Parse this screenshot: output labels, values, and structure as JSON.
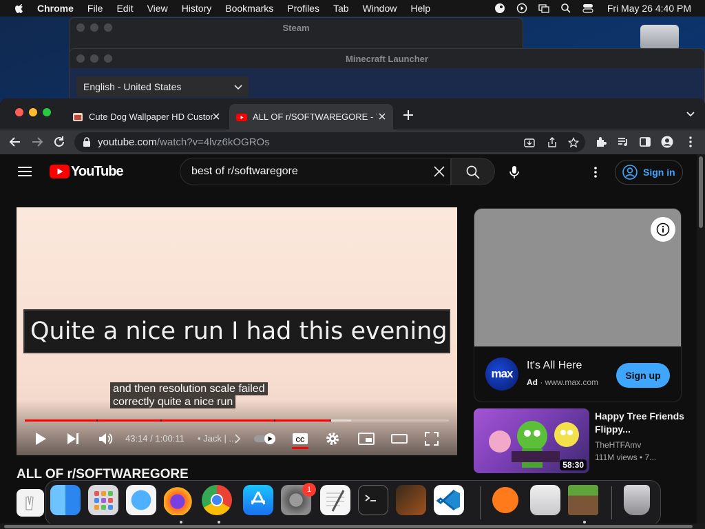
{
  "menubar": {
    "app": "Chrome",
    "items": [
      "File",
      "Edit",
      "View",
      "History",
      "Bookmarks",
      "Profiles",
      "Tab",
      "Window",
      "Help"
    ],
    "clock": "Fri May 26  4:40 PM"
  },
  "background_windows": {
    "steam_title": "Steam",
    "minecraft_title": "Minecraft Launcher",
    "language_select": "English - United States"
  },
  "browser": {
    "tabs": [
      {
        "label": "Cute Dog Wallpaper HD Custom",
        "active": false
      },
      {
        "label": "ALL OF r/SOFTWAREGORE - YouTube",
        "active": true
      }
    ],
    "url_host": "youtube.com",
    "url_path": "/watch?v=4lvz6kOGROs"
  },
  "youtube": {
    "logo_text": "YouTube",
    "search_value": "best of r/softwaregore",
    "sign_in_label": "Sign in",
    "player": {
      "burned_in_caption": "Quite a nice run I had this evening",
      "caption_line1": "and then resolution scale failed",
      "caption_line2": "correctly quite a nice run",
      "time": "43:14 / 1:00:11",
      "chapter": "• Jack | ...",
      "progress_played_fraction": 0.72,
      "progress_loaded_fraction": 0.77
    },
    "video_title": "ALL OF r/SOFTWAREGORE",
    "ad": {
      "logo_text": "max",
      "title": "It's All Here",
      "ad_label": "Ad",
      "domain": "www.max.com",
      "cta": "Sign up"
    },
    "recommendation": {
      "title": "Happy Tree Friends Flippy...",
      "channel": "TheHTFAmv",
      "views": "111M views  • 7...",
      "duration": "58:30"
    }
  },
  "dock": {
    "notification_badge": "1",
    "apps": [
      "Finder",
      "Launchpad",
      "Safari",
      "Firefox",
      "Chrome",
      "App Store",
      "System Settings",
      "TextEdit",
      "Terminal",
      "GarageBand",
      "Visual Studio Code",
      "Sublime",
      "Disk Utility",
      "Minecraft",
      "Trash"
    ]
  },
  "colors": {
    "youtube_red": "#ff0000",
    "signin_blue": "#3ea6ff",
    "page_bg": "#0f0f0f"
  }
}
